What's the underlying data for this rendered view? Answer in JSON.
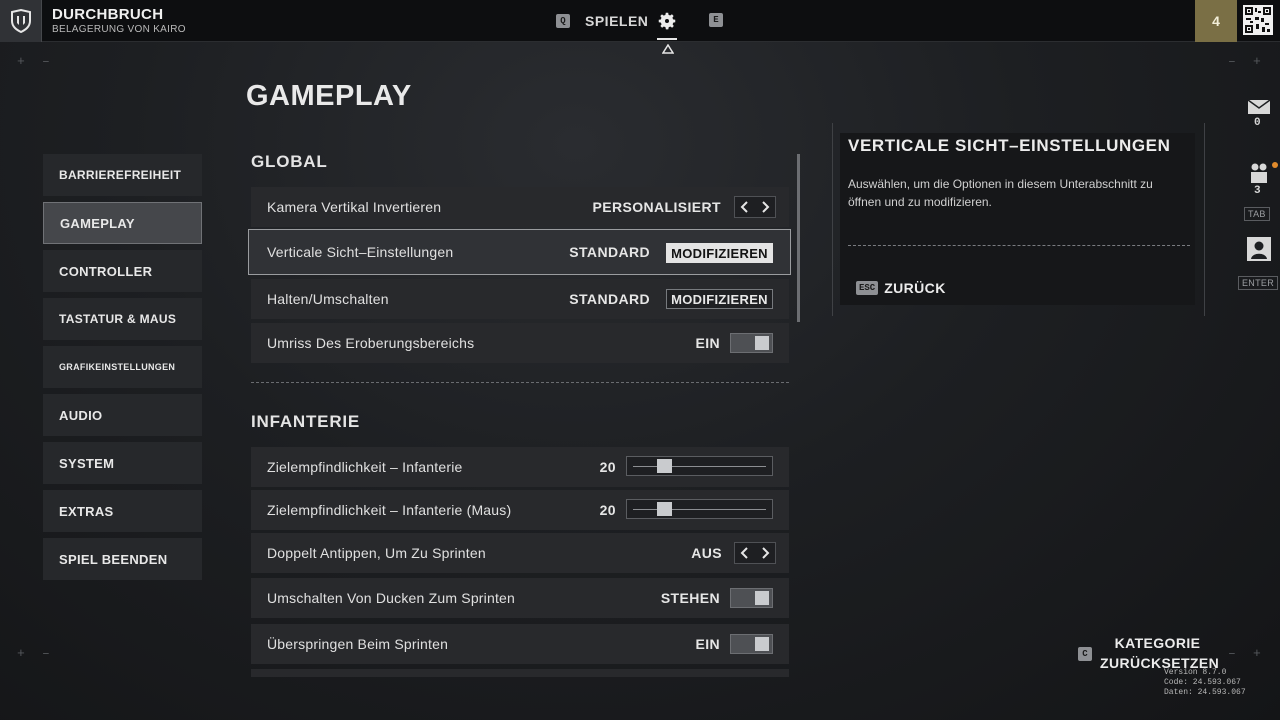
{
  "topbar": {
    "mode_title": "DURCHBRUCH",
    "mode_subtitle": "BELAGERUNG VON KAIRO",
    "nav_left_key": "Q",
    "nav_play_label": "SPIELEN",
    "nav_right_key": "E",
    "level": "4"
  },
  "page_title": "GAMEPLAY",
  "sidebar": {
    "items": [
      {
        "label": "BARRIEREFREIHEIT"
      },
      {
        "label": "GAMEPLAY"
      },
      {
        "label": "CONTROLLER"
      },
      {
        "label": "TASTATUR & MAUS"
      },
      {
        "label": "GRAFIKEINSTELLUNGEN"
      },
      {
        "label": "AUDIO"
      },
      {
        "label": "SYSTEM"
      },
      {
        "label": "EXTRAS"
      },
      {
        "label": "SPIEL BEENDEN"
      }
    ]
  },
  "global": {
    "title": "GLOBAL",
    "rows": [
      {
        "label": "Kamera Vertikal Invertieren",
        "value": "PERSONALISIERT"
      },
      {
        "label": "Verticale Sicht–Einstellungen",
        "value": "STANDARD",
        "button": "MODIFIZIEREN"
      },
      {
        "label": "Halten/Umschalten",
        "value": "STANDARD",
        "button": "MODIFIZIEREN"
      },
      {
        "label": "Umriss Des Eroberungsbereichs",
        "value": "EIN"
      }
    ]
  },
  "infanterie": {
    "title": "INFANTERIE",
    "rows": [
      {
        "label": "Zielempfindlichkeit – Infanterie",
        "value": "20",
        "slider_fraction": 0.2
      },
      {
        "label": "Zielempfindlichkeit – Infanterie (Maus)",
        "value": "20",
        "slider_fraction": 0.2
      },
      {
        "label": "Doppelt Antippen, Um Zu Sprinten",
        "value": "AUS"
      },
      {
        "label": "Umschalten Von Ducken Zum Sprinten",
        "value": "STEHEN"
      },
      {
        "label": "Überspringen Beim Sprinten",
        "value": "EIN"
      }
    ]
  },
  "info": {
    "title": "VERTICALE SICHT–EINSTELLUNGEN",
    "description": "Auswählen, um die Optionen in diesem Unterabschnitt zu öffnen und zu modifizieren.",
    "back_key": "ESC",
    "back_label": "ZURÜCK"
  },
  "rail": {
    "mail_count": "0",
    "squad_count": "3",
    "squad_key": "TAB",
    "profile_key": "ENTER"
  },
  "reset": {
    "key": "C",
    "label": "KATEGORIE ZURÜCKSETZEN"
  },
  "version": {
    "line1": "Version 8.7.0",
    "line2": "Code: 24.593.067",
    "line3": "Daten: 24.593.067"
  },
  "colors": {
    "level_badge": "#7a6f45",
    "notification_dot": "#e08a2c",
    "active_button": "#e4e4e4"
  },
  "icons": [
    "shield-icon",
    "gear-icon",
    "caret-up-icon",
    "qr-icon",
    "mail-icon",
    "squad-icon",
    "profile-icon",
    "chevron-left-icon",
    "chevron-right-icon"
  ]
}
